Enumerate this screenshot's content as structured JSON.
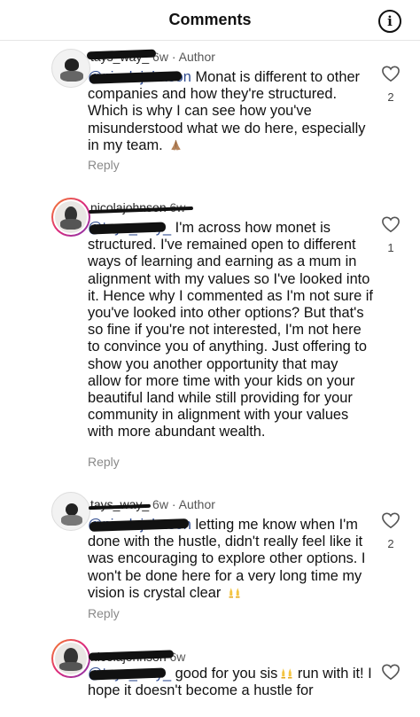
{
  "header": {
    "title": "Comments",
    "info_icon": "info-circle-icon",
    "info_glyph": "i"
  },
  "comments": [
    {
      "username": "tays_way_",
      "time": "6w",
      "separator": "·",
      "author_badge": "Author",
      "mention": "@nicolajohnson",
      "text": "Monat is different to other companies and how they're structured. Which is why I can see how you've misunderstood what we do here, especially in my team.",
      "emoji": "folded-hands-icon",
      "reply_label": "Reply",
      "like_count": "2"
    },
    {
      "username": "nicolajohnson",
      "time": "6w",
      "mention": "@tays_way_",
      "text": "I'm across how monet is structured. I've remained open to different ways of learning and earning as a mum in alignment with my values so I've looked into it. Hence why I commented as I'm not sure if you've looked into other options? But that's so fine if you're not interested, I'm not here to convince you of anything. Just offering to show you another opportunity that may allow for more time with your kids on your beautiful land while still providing for your community in alignment with your values with more abundant wealth.",
      "reply_label": "Reply",
      "like_count": "1"
    },
    {
      "username": "tays_way_",
      "time": "6w",
      "separator": "·",
      "author_badge": "Author",
      "mention": "@nicolajohnson",
      "text": "letting me know when I'm done with the hustle, didn't really feel like it was encouraging to explore other options. I won't be done here for a very long time my vision is crystal clear",
      "emoji": "raising-hands-icon",
      "reply_label": "Reply",
      "like_count": "2"
    },
    {
      "username": "nicolajohnson",
      "time": "6w",
      "mention": "@tays_way_",
      "text_before_emoji": "good for you sis",
      "emoji": "raising-hands-icon",
      "text_after_emoji": "run with it! I hope it doesn't become a hustle for"
    }
  ],
  "colors": {
    "mention": "#2e4a8f",
    "meta": "#555555",
    "reply": "#8a8a8a"
  }
}
